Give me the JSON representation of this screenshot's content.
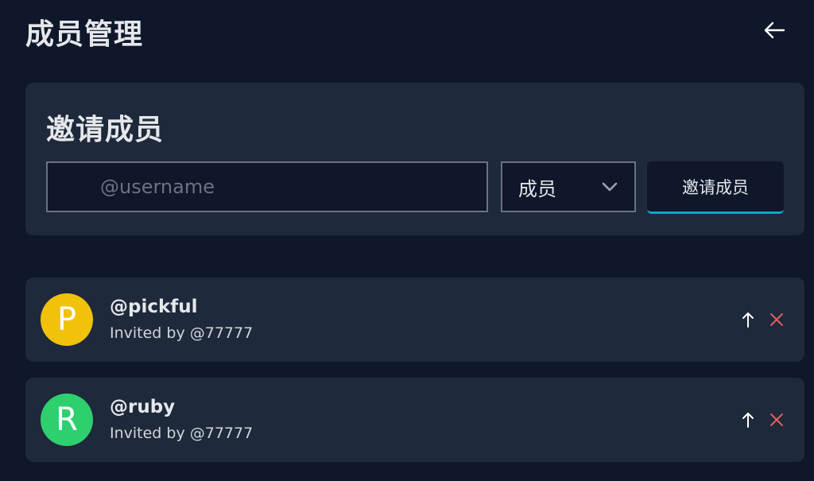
{
  "header": {
    "title": "成员管理",
    "back_icon": "arrow-left-icon"
  },
  "invite": {
    "title": "邀请成员",
    "username_placeholder": "@username",
    "username_value": "",
    "role_selected": "成员",
    "button_label": "邀请成员"
  },
  "members": [
    {
      "initial": "P",
      "username": "@pickful",
      "invited_by": "Invited by @77777",
      "avatar_color": "#f0c20a"
    },
    {
      "initial": "R",
      "username": "@ruby",
      "invited_by": "Invited by @77777",
      "avatar_color": "#2ed06e"
    }
  ],
  "colors": {
    "background": "#0f172a",
    "card": "#1e293b",
    "accent": "#0ea5c6",
    "danger": "#e0605c"
  },
  "icons": {
    "select": "chevron-down-icon",
    "promote": "arrow-up-icon",
    "remove": "close-icon"
  }
}
